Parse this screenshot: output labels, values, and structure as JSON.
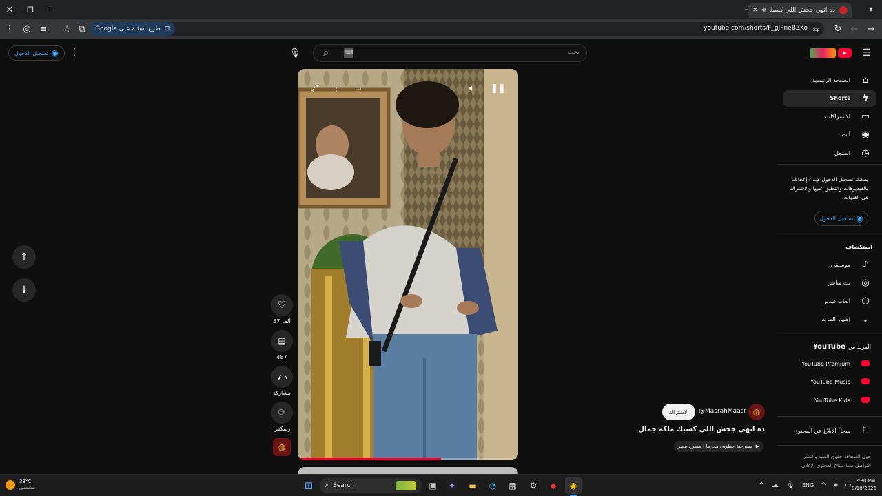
{
  "browser": {
    "tab_title": "ده انهي جحش اللي كسبك ملكة جمال",
    "url": "youtube.com/shorts/F_gJPneBZKo",
    "google_prompt": "طرح أسئلة على Google"
  },
  "youtube": {
    "signin_label": "تسجيل الدخول",
    "search_placeholder": "بحث",
    "nav": [
      {
        "label": "الصفحة الرئيسية",
        "icon": "home-icon",
        "active": false
      },
      {
        "label": "Shorts",
        "icon": "shorts-icon",
        "active": true
      },
      {
        "label": "الاشتراكات",
        "icon": "subscriptions-icon",
        "active": false
      },
      {
        "label": "أنت",
        "icon": "you-icon",
        "active": false
      },
      {
        "label": "السجل",
        "icon": "history-icon",
        "active": false
      }
    ],
    "signin_prompt": "يمكنك تسجيل الدخول لإبداء إعجابك بالفيديوهات والتعليق عليها والاشتراك في القنوات.",
    "signin_button": "تسجيل الدخول",
    "explore_header": "استكشاف",
    "explore": [
      {
        "label": "موسيقى",
        "icon": "music-icon"
      },
      {
        "label": "بث مباشر",
        "icon": "live-icon"
      },
      {
        "label": "ألعاب فيديو",
        "icon": "gaming-icon"
      },
      {
        "label": "إظهار المزيد",
        "icon": "chevron-down-icon"
      }
    ],
    "more_header_prefix": "المزيد من",
    "more_header_brand": "YouTube",
    "more": [
      {
        "label": "YouTube Premium"
      },
      {
        "label": "YouTube Music"
      },
      {
        "label": "YouTube Kids"
      }
    ],
    "report_label": "سجلّ الإبلاغ عن المحتوى",
    "footer_line1": "حول  الصحافة  حقوق الطبع والنشر",
    "footer_line2": "التواصل معنا  صنّاع المحتوى  الإعلان"
  },
  "short": {
    "likes": "57 ألف",
    "comments": "487",
    "share_label": "مشاركة",
    "remix_label": "ريمكس",
    "channel": "@MasrahMaasr",
    "subscribe": "الاشتراك",
    "title": "ده انهي جحش اللي كسبك ملكة جمال",
    "playlist": "مسرحية جطونى مجرما | مسرح مصر",
    "progress": 0.65
  },
  "taskbar": {
    "weather_temp": "33°C",
    "weather_desc": "مشمس",
    "search_label": "Search",
    "lang": "ENG",
    "time": "2:30 PM",
    "date": "8/18/2026"
  },
  "colors": {
    "accent": "#3ea6ff",
    "brand_red": "#ff0033",
    "progress": "#ff0033"
  }
}
